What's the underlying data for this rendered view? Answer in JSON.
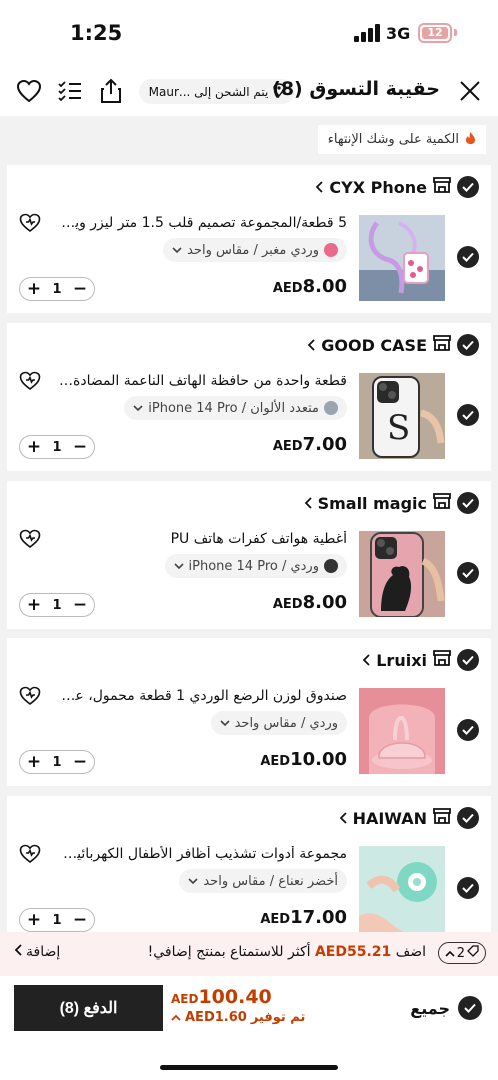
{
  "status_bar": {
    "time": "1:25",
    "network": "3G",
    "battery": "12"
  },
  "header": {
    "title": "حقيبة التسوق (8)",
    "shipping": "يتم الشحن إلى ...Maur"
  },
  "stock_note": "الكمية على وشك الإنتهاء",
  "colors": {
    "accent": "#c43d00",
    "dark": "#222222",
    "promo_bg": "#fdf0f0"
  },
  "cart": [
    {
      "store": "CYX Phone",
      "title": "5 قطعة/المجموعة تصميم قلب 1.5 متر ليزر ويند...",
      "variant": "وردي مغبر / مقاس واحد",
      "swatch": "#e86a8d",
      "quantity": "1",
      "price_amount": "8.00",
      "currency": "AED"
    },
    {
      "store": "GOOD CASE",
      "title": "قطعة واحدة من حافظة الهاتف الناعمة المضادة للـ...",
      "variant": "متعدد الألوان / iPhone 14 Pro",
      "swatch": "#9aa5b1",
      "quantity": "1",
      "price_amount": "7.00",
      "currency": "AED"
    },
    {
      "store": "Small magic",
      "title": "أغطية هواتف كفرات هاتف PU",
      "variant": "وردي / iPhone 14 Pro",
      "swatch": "#333333",
      "quantity": "1",
      "price_amount": "8.00",
      "currency": "AED"
    },
    {
      "store": "Lruixi",
      "title": "صندوق لوزن الرضع الوردي 1 قطعة محمول، علبة...",
      "variant": "وردي / مقاس واحد",
      "swatch": "",
      "quantity": "1",
      "price_amount": "10.00",
      "currency": "AED"
    },
    {
      "store": "HAIWAN",
      "title": "مجموعة أدوات تشذيب أظافر الأطفال الكهربائية م...",
      "variant": "أخضر نعناع / مقاس واحد",
      "swatch": "",
      "quantity": "1",
      "price_amount": "17.00",
      "currency": "AED"
    }
  ],
  "promo": {
    "count": "2",
    "prefix": "اضف",
    "amount": "AED55.21",
    "suffix": "أكثر للاستمتاع بمنتج إضافي!",
    "add_label": "إضافة"
  },
  "checkout": {
    "pay_label": "الدفع (8)",
    "total_currency": "AED",
    "total_amount": "100.40",
    "saving_label": "تم توفير",
    "saving_amount": "AED1.60",
    "all_label": "جميع"
  }
}
